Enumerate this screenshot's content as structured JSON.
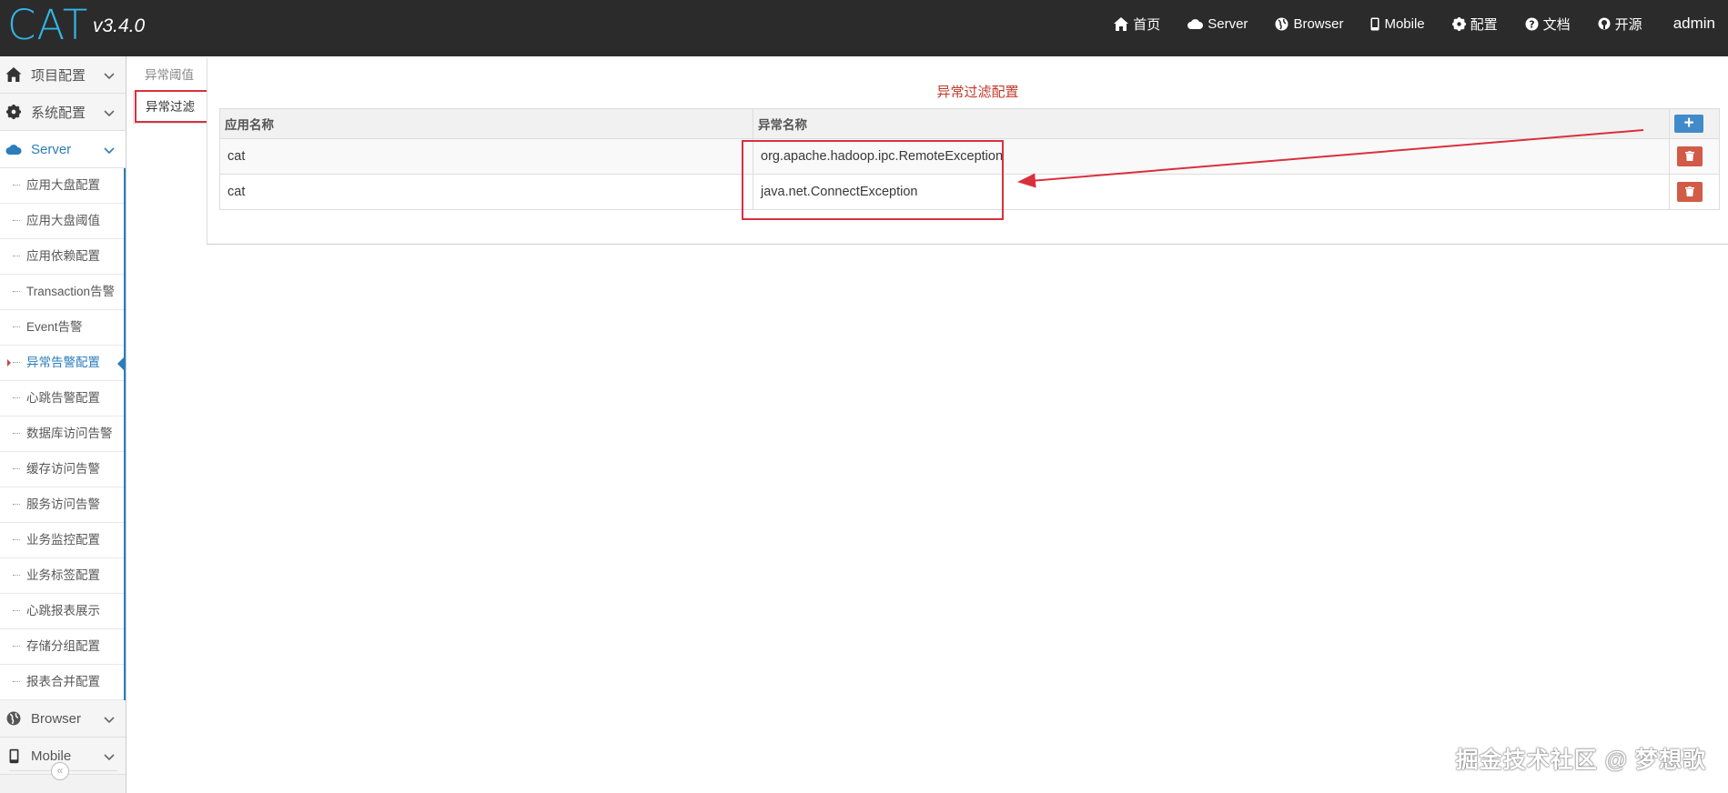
{
  "app": {
    "logo": "CAT",
    "version": "v3.4.0"
  },
  "navbar": {
    "items": [
      {
        "label": "首页",
        "icon": "home-icon"
      },
      {
        "label": "Server",
        "icon": "cloud-icon"
      },
      {
        "label": "Browser",
        "icon": "globe-icon"
      },
      {
        "label": "Mobile",
        "icon": "mobile-icon"
      },
      {
        "label": "配置",
        "icon": "gear-icon"
      },
      {
        "label": "文档",
        "icon": "question-icon"
      },
      {
        "label": "开源",
        "icon": "github-icon"
      }
    ],
    "user": "admin"
  },
  "sidebar": {
    "groups": [
      {
        "label": "项目配置",
        "icon": "home-icon"
      },
      {
        "label": "系统配置",
        "icon": "gear-icon"
      },
      {
        "label": "Server",
        "icon": "cloud-icon",
        "active": true
      },
      {
        "label": "Browser",
        "icon": "globe-icon"
      },
      {
        "label": "Mobile",
        "icon": "mobile-icon"
      }
    ],
    "server_items": [
      "应用大盘配置",
      "应用大盘阈值",
      "应用依赖配置",
      "Transaction告警",
      "Event告警",
      "异常告警配置",
      "心跳告警配置",
      "数据库访问告警",
      "缓存访问告警",
      "服务访问告警",
      "业务监控配置",
      "业务标签配置",
      "心跳报表展示",
      "存储分组配置",
      "报表合并配置"
    ],
    "active_item": "异常告警配置",
    "collapse_symbol": "«"
  },
  "subtabs": {
    "threshold": "异常阈值",
    "filter": "异常过滤",
    "active": "异常过滤"
  },
  "panel": {
    "title": "异常过滤配置",
    "columns": {
      "app": "应用名称",
      "exception": "异常名称"
    },
    "add_symbol": "+",
    "delete_symbol": "🗑",
    "rows": [
      {
        "app": "cat",
        "exception": "org.apache.hadoop.ipc.RemoteException"
      },
      {
        "app": "cat",
        "exception": "java.net.ConnectException"
      }
    ]
  },
  "watermark": "掘金技术社区 @ 梦想歌",
  "colors": {
    "accent": "#2b7dbc",
    "annotation": "#d9303e",
    "title": "#c0392b",
    "add": "#428bca",
    "delete": "#d15b47"
  }
}
